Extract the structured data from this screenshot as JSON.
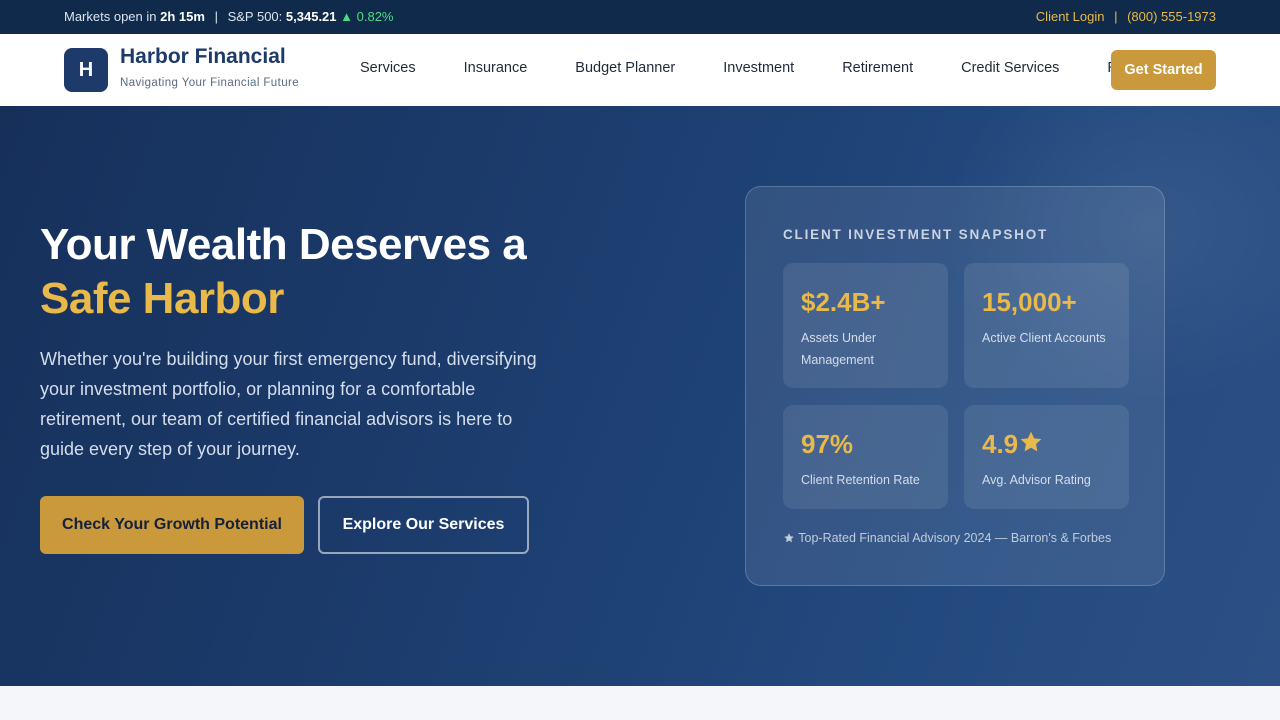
{
  "topbar": {
    "market_prefix": "Markets open in",
    "market_time": "2h 15m",
    "index_label": "S&P 500:",
    "index_value": "5,345.21",
    "index_change": "▲ 0.82%",
    "client_login": "Client Login",
    "phone": "(800) 555-1973"
  },
  "header": {
    "logo_letter": "H",
    "brand": "Harbor Financial",
    "tagline": "Navigating Your Financial Future",
    "nav": [
      "Services",
      "Insurance",
      "Budget Planner",
      "Investment",
      "Retirement",
      "Credit Services",
      "Resources"
    ],
    "cta": "Get Started"
  },
  "hero": {
    "title_line1": "Your Wealth Deserves a",
    "title_line2": "Safe Harbor",
    "lead": "Whether you're building your first emergency fund, diversifying your investment portfolio, or planning for a comfortable retirement, our team of certified financial advisors is here to guide every step of your journey.",
    "primary_button": "Check Your Growth Potential",
    "secondary_button": "Explore Our Services"
  },
  "snapshot": {
    "title": "CLIENT INVESTMENT SNAPSHOT",
    "stats": [
      {
        "value": "$2.4B+",
        "label": "Assets Under Management"
      },
      {
        "value": "15,000+",
        "label": "Active Client Accounts"
      },
      {
        "value": "97%",
        "label": "Client Retention Rate"
      },
      {
        "value": "4.9",
        "label": "Avg. Advisor Rating"
      }
    ],
    "note": "Top-Rated Financial Advisory 2024 — Barron's & Forbes"
  },
  "colors": {
    "navy": "#1e3a6b",
    "gold": "#c9993c",
    "gold_text": "#e9b949",
    "positive": "#4ade80"
  }
}
